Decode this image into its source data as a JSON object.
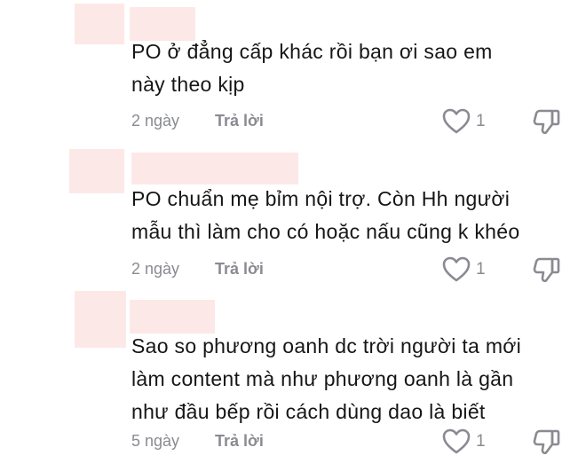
{
  "comments": [
    {
      "text_lines": [
        "PO ở đẳng cấp khác rồi bạn ơi sao em",
        "này theo kịp"
      ],
      "time": "2 ngày",
      "reply_label": "Trả lời",
      "likes": "1"
    },
    {
      "text_lines": [
        "PO chuẩn mẹ bỉm nội trợ. Còn Hh người",
        "mẫu thì làm cho có hoặc nấu cũng k khéo"
      ],
      "time": "2 ngày",
      "reply_label": "Trả lời",
      "likes": "1"
    },
    {
      "text_lines": [
        "Sao so phương oanh dc trời người ta mới",
        "làm content mà như phương oanh là gần",
        "như đầu bếp rồi cách dùng dao là biết"
      ],
      "time": "5 ngày",
      "reply_label": "Trả lời",
      "likes": "1"
    }
  ],
  "icons": {
    "like": "heart-outline-icon",
    "dislike": "thumbs-down-outline-icon"
  },
  "colors": {
    "redacted": "#fde8e8",
    "meta_text": "#8a8b91",
    "body_text": "#161616"
  }
}
